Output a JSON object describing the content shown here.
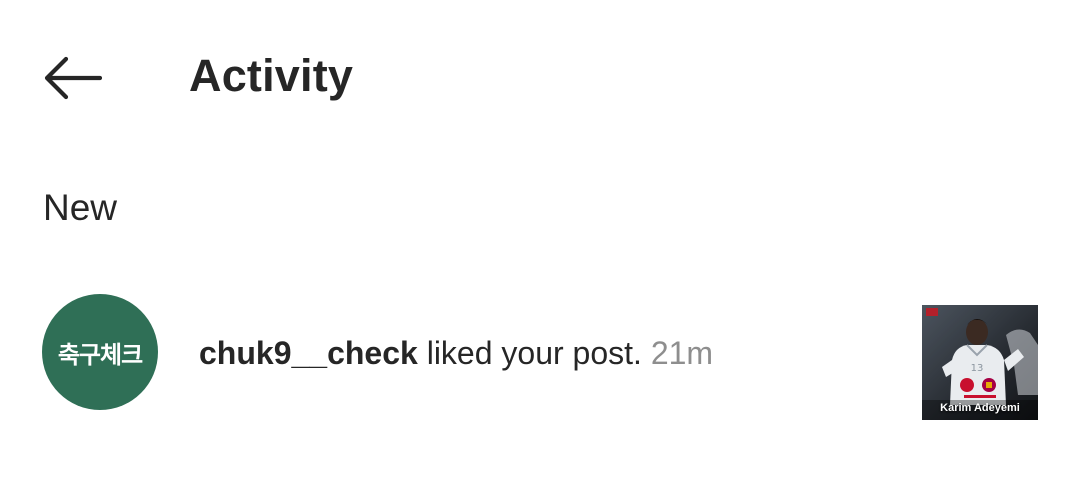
{
  "header": {
    "title": "Activity",
    "back_icon": "arrow-left-icon"
  },
  "section": {
    "label": "New"
  },
  "activity": {
    "avatar_text": "축구체크",
    "avatar_color": "#2f6f56",
    "username": "chuk9__check",
    "action": "liked your post.",
    "time": "21m",
    "time_color": "#8e8e8e",
    "post_caption": "Karim Adeyemi"
  }
}
